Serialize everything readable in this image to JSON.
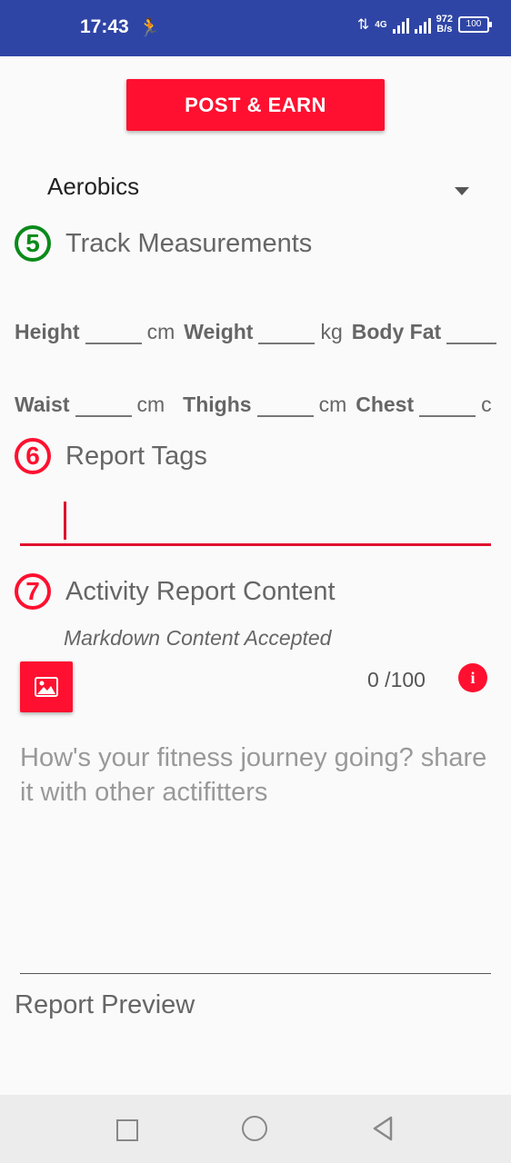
{
  "status_bar": {
    "time": "17:43",
    "network": "4G",
    "speed_value": "972",
    "speed_unit": "B/s",
    "battery": "100"
  },
  "post_button_label": "POST & EARN",
  "activity_dropdown": {
    "selected": "Aerobics"
  },
  "sections": {
    "measurements": {
      "number": "5",
      "title": "Track Measurements"
    },
    "tags": {
      "number": "6",
      "title": "Report Tags"
    },
    "content": {
      "number": "7",
      "title": "Activity Report Content"
    }
  },
  "measurements": {
    "row1": [
      {
        "label": "Height",
        "unit": "cm"
      },
      {
        "label": "Weight",
        "unit": "kg"
      },
      {
        "label": "Body Fat",
        "unit": ""
      }
    ],
    "row2": [
      {
        "label": "Waist",
        "unit": "cm"
      },
      {
        "label": "Thighs",
        "unit": "cm"
      },
      {
        "label": "Chest",
        "unit": "c"
      }
    ]
  },
  "markdown_note": "Markdown Content Accepted",
  "char_counter": "0  /100",
  "content_placeholder": "How's your fitness journey going? share it with other actifitters",
  "preview_label": "Report Preview",
  "colors": {
    "accent": "#ff1030",
    "status_bar": "#2f45a6",
    "step_green": "#0a8a1a"
  }
}
